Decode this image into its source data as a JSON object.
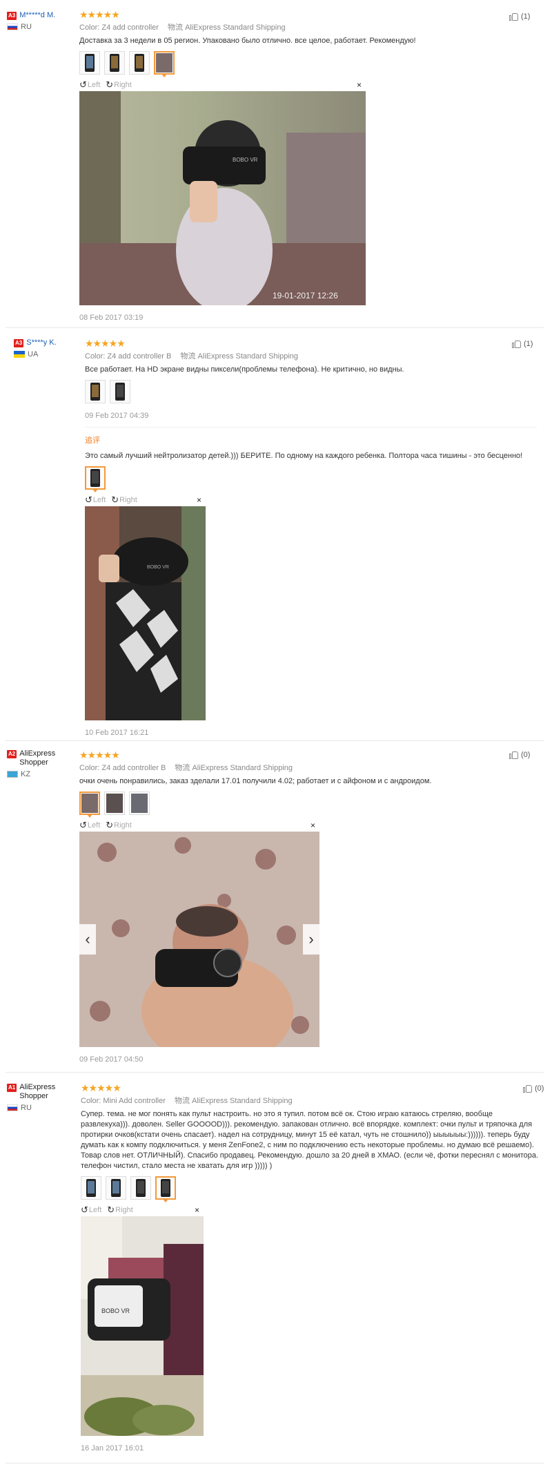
{
  "reviews": [
    {
      "level": "A3",
      "name": "M*****d M.",
      "country": "RU",
      "color_label": "Color:",
      "color_value": "Z4 add controller",
      "ship_label": "物流",
      "ship_value": "AliExpress Standard Shipping",
      "text": "Доставка за 3 недели в 05 регион. Упаковано было отлично. все целое, работает. Рекомендую!",
      "rotate_left": "Left",
      "rotate_right": "Right",
      "photo_stamp": "19-01-2017 12:26",
      "logo_text": "BOBO VR",
      "date": "08 Feb 2017 03:19",
      "likes": "(1)"
    },
    {
      "level": "A3",
      "name": "S****y K.",
      "country": "UA",
      "color_label": "Color:",
      "color_value": "Z4 add controller B",
      "ship_label": "物流",
      "ship_value": "AliExpress Standard Shipping",
      "text": "Все работает. На HD экране видны пиксели(проблемы телефона). Не критично, но видны.",
      "date": "09 Feb 2017 04:39",
      "additional_label": "追评",
      "additional_text": "Это самый лучший нейтролизатор детей.))) БЕРИТЕ. По одному на каждого ребенка. Полтора часа тишины - это бесценно!",
      "rotate_left": "Left",
      "rotate_right": "Right",
      "logo_text": "BOBO VR",
      "additional_date": "10 Feb 2017 16:21",
      "likes": "(1)"
    },
    {
      "level": "A2",
      "name": "AliExpress Shopper",
      "country": "KZ",
      "color_label": "Color:",
      "color_value": "Z4 add controller B",
      "ship_label": "物流",
      "ship_value": "AliExpress Standard Shipping",
      "text": "очки очень понравились, заказ зделали 17.01 получили 4.02; работает и с айфоном и с андроидом.",
      "rotate_left": "Left",
      "rotate_right": "Right",
      "prev_arrow": "‹",
      "next_arrow": "›",
      "date": "09 Feb 2017 04:50",
      "likes": "(0)"
    },
    {
      "level": "A1",
      "name": "AliExpress Shopper",
      "country": "RU",
      "color_label": "Color:",
      "color_value": "Mini Add controller",
      "ship_label": "物流",
      "ship_value": "AliExpress Standard Shipping",
      "text": "Супер. тема. не мог понять как пульт настроить. но это я тупил. потом всё ок. Стою играю катаюсь стреляю, вообще развлекуха))). доволен. Seller GOOOOD))). рекомендую. запакован отлично. всё впорядке. комплект: очки пульт и тряпочка для протирки очков(кстати очень спасает). надел на сотрудницу, минут 15 её катал, чуть не стошнило)) ыыыыыы:)))))). теперь буду думать как к компу подключиться. у меня ZenFone2, с ним по подключению есть некоторые проблемы. но думаю всё решаемо). Товар слов нет. ОТЛИЧНЫЙ). Спасибо продавец. Рекомендую. дошло за 20 дней в ХМАО. (если чё, фотки переснял с монитора. телефон чистил, стало места не хватать для игр ))))) )",
      "rotate_left": "Left",
      "rotate_right": "Right",
      "logo_text": "BOBO VR",
      "date": "16 Jan 2017 16:01",
      "likes": "(0)"
    }
  ],
  "stars": "★★★★★",
  "icons": {
    "rotate_left": "rotate-left-icon",
    "rotate_right": "rotate-right-icon",
    "close": "close-icon",
    "like": "thumbs-up-icon"
  },
  "close_glyph": "×",
  "rot_left_glyph": "↺",
  "rot_right_glyph": "↻",
  "colors": {
    "accent": "#f39a3a",
    "star": "#f5a623",
    "level_badge": "#e0201c",
    "link": "#1a5fb4"
  }
}
